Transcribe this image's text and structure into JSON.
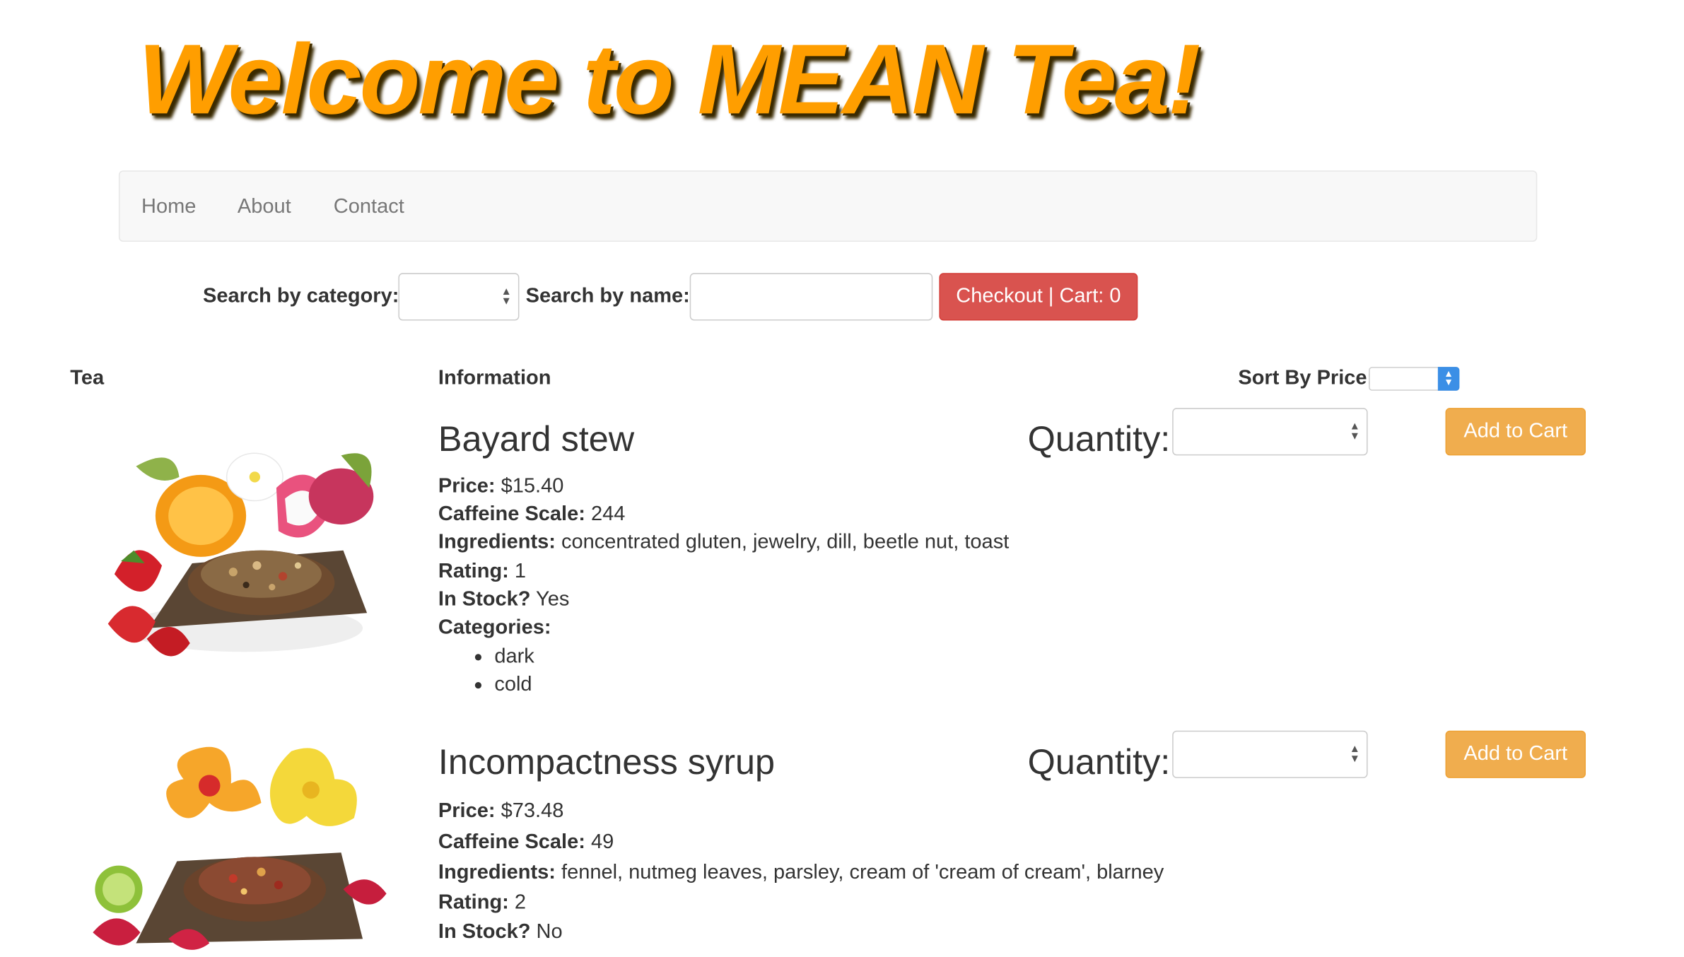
{
  "header": {
    "title": "Welcome to MEAN Tea!"
  },
  "nav": {
    "items": [
      "Home",
      "About",
      "Contact"
    ]
  },
  "search": {
    "category_label": "Search by category:",
    "category_value": "",
    "name_label": "Search by name:",
    "name_value": "",
    "checkout_label": "Checkout | Cart: 0"
  },
  "table": {
    "col_tea": "Tea",
    "col_info": "Information",
    "sort_label": "Sort By Price:",
    "sort_value": ""
  },
  "labels": {
    "quantity": "Quantity:",
    "add_to_cart": "Add to Cart",
    "price": "Price:",
    "caffeine": "Caffeine Scale:",
    "ingredients": "Ingredients:",
    "rating": "Rating:",
    "in_stock": "In Stock?",
    "categories": "Categories:"
  },
  "teas": [
    {
      "name": "Bayard stew",
      "price": "$15.40",
      "caffeine": "244",
      "ingredients": "concentrated gluten, jewelry, dill, beetle nut, toast",
      "rating": "1",
      "in_stock": "Yes",
      "categories": [
        "dark",
        "cold"
      ],
      "quantity_value": "",
      "image_icon": "tea-blend-with-fruit-image"
    },
    {
      "name": "Incompactness syrup",
      "price": "$73.48",
      "caffeine": "49",
      "ingredients": "fennel, nutmeg leaves, parsley, cream of 'cream of cream', blarney",
      "rating": "2",
      "in_stock": "No",
      "quantity_value": "",
      "image_icon": "tea-blend-with-hibiscus-image"
    }
  ],
  "colors": {
    "title": "#ff9e00",
    "checkout": "#d9534f",
    "add_to_cart": "#f0ad4e",
    "navbar_bg": "#f8f8f8"
  }
}
